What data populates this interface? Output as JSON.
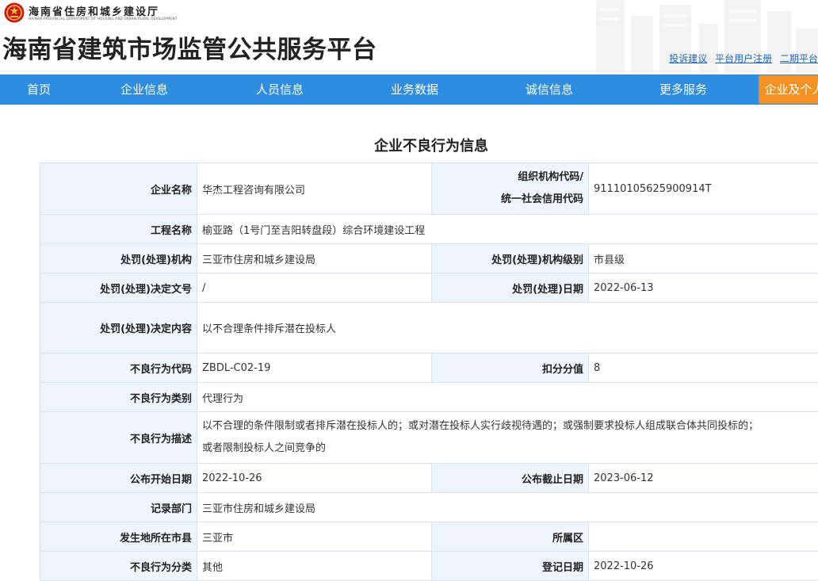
{
  "header": {
    "dept_name": "海南省住房和城乡建设厅",
    "dept_name_en": "HAINAN PROVINCIAL DEPARTMENT OF HOUSING AND URBAN-RURAL DEVELOPMENT",
    "site_title": "海南省建筑市场监管公共服务平台",
    "links": [
      "投诉建议",
      "平台用户注册",
      "二期平台"
    ]
  },
  "nav": {
    "items": [
      "首页",
      "企业信息",
      "人员信息",
      "业务数据",
      "诚信信息",
      "更多服务"
    ],
    "active": "企业及个人"
  },
  "page_title": "企业不良行为信息",
  "labels": {
    "company_name": "企业名称",
    "org_code_1": "组织机构代码/",
    "org_code_2": "统一社会信用代码",
    "project_name": "工程名称",
    "penalty_org": "处罚(处理)机构",
    "penalty_org_level": "处罚(处理)机构级别",
    "decision_no": "处罚(处理)决定文号",
    "penalty_date": "处罚(处理)日期",
    "decision_content": "处罚(处理)决定内容",
    "behavior_code": "不良行为代码",
    "deduct_score": "扣分分值",
    "behavior_category": "不良行为类别",
    "behavior_desc": "不良行为描述",
    "publish_start": "公布开始日期",
    "publish_end": "公布截止日期",
    "record_dept": "记录部门",
    "city": "发生地所在市县",
    "district": "所属区",
    "behavior_class": "不良行为分类",
    "register_date": "登记日期"
  },
  "values": {
    "company_name": "华杰工程咨询有限公司",
    "org_code": "91110105625900914T",
    "project_name": "榆亚路（1号门至吉阳转盘段）综合环境建设工程",
    "penalty_org": "三亚市住房和城乡建设局",
    "penalty_org_level": "市县级",
    "decision_no": "/",
    "penalty_date": "2022-06-13",
    "decision_content": "以不合理条件排斥潜在投标人",
    "behavior_code": "ZBDL-C02-19",
    "deduct_score": "8",
    "behavior_category": "代理行为",
    "behavior_desc_1": "以不合理的条件限制或者排斥潜在投标人的；或对潜在投标人实行歧视待遇的；或强制要求投标人组成联合体共同投标的；",
    "behavior_desc_2": "或者限制投标人之间竞争的",
    "publish_start": "2022-10-26",
    "publish_end": "2023-06-12",
    "record_dept": "三亚市住房和城乡建设局",
    "city": "三亚市",
    "district": "",
    "behavior_class": "其他",
    "register_date": "2022-10-26"
  },
  "colors": {
    "nav_bg": "#2e8de0",
    "nav_active_bg": "#f39222",
    "label_bg": "#eef4fb",
    "border": "#d9e3ee",
    "link": "#1b64b8"
  }
}
